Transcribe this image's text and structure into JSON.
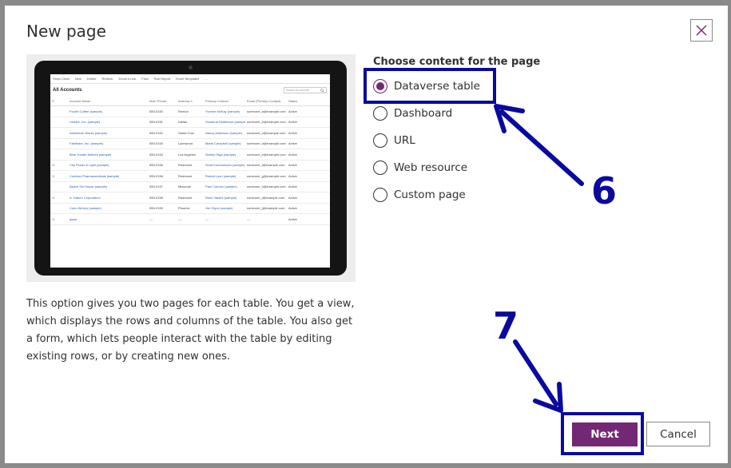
{
  "dialog": {
    "title": "New page",
    "close_icon": "close-icon",
    "description": "This option gives you two pages for each table. You get a view, which displays the rows and columns of the table. You also get a form, which lets people interact with the table by editing existing rows, or by creating new ones."
  },
  "preview": {
    "command_bar": [
      "Show Chart",
      "New",
      "Delete",
      "Refresh",
      "Email a Link",
      "Flow",
      "Run Report",
      "Excel Templates",
      "..."
    ],
    "view_title": "All Accounts",
    "search_placeholder": "Search for records",
    "columns": [
      "Account Name",
      "Main Phone",
      "Address 1",
      "Primary Contact",
      "Email (Primary Contact)",
      "Status"
    ],
    "rows": [
      [
        "Fourth Coffee (sample)",
        "555-0150",
        "Renton",
        "Yvonne McKay (sample)",
        "someone_a@example.com",
        "Active"
      ],
      [
        "Litware, Inc. (sample)",
        "555-0151",
        "Dallas",
        "Susanna Stubberod (sample)",
        "someone_b@example.com",
        "Active"
      ],
      [
        "Adventure Works (sample)",
        "555-0152",
        "Santa Cruz",
        "Nancy Anderson (sample)",
        "someone_c@example.com",
        "Active"
      ],
      [
        "Fabrikam, Inc. (sample)",
        "555-0153",
        "Lynnwood",
        "Maria Campbell (sample)",
        "someone_d@example.com",
        "Active"
      ],
      [
        "Blue Yonder Airlines (sample)",
        "555-0154",
        "Los Angeles",
        "Sidney Higa (sample)",
        "someone_e@example.com",
        "Active"
      ],
      [
        "City Power & Light (sample)",
        "555-0155",
        "Redmond",
        "Scott Konersmann (sample)",
        "someone_f@example.com",
        "Active"
      ],
      [
        "Contoso Pharmaceuticals (sample)",
        "555-0156",
        "Redmond",
        "Robert Lyon (sample)",
        "someone_g@example.com",
        "Active"
      ],
      [
        "Alpine Ski House (sample)",
        "555-0157",
        "Missoula",
        "Paul Cannon (sample)",
        "someone_h@example.com",
        "Active"
      ],
      [
        "A. Datum Corporation",
        "555-0158",
        "Redmond",
        "Rene Valdes (sample)",
        "someone_i@example.com",
        "Active"
      ],
      [
        "Coho Winery (sample)",
        "555-0159",
        "Phoenix",
        "Jim Glynn (sample)",
        "someone_j@example.com",
        "Active"
      ],
      [
        "aaaa",
        "---",
        "---",
        "---",
        "---",
        "Active"
      ]
    ]
  },
  "content": {
    "label": "Choose content for the page",
    "options": [
      {
        "label": "Dataverse table",
        "checked": true
      },
      {
        "label": "Dashboard",
        "checked": false
      },
      {
        "label": "URL",
        "checked": false
      },
      {
        "label": "Web resource",
        "checked": false
      },
      {
        "label": "Custom page",
        "checked": false
      }
    ]
  },
  "annotations": {
    "step6": "6",
    "step7": "7",
    "color": "#0a0a9e"
  },
  "footer": {
    "next_label": "Next",
    "cancel_label": "Cancel"
  },
  "colors": {
    "accent": "#742774",
    "overlay": "#8a8a8a"
  }
}
